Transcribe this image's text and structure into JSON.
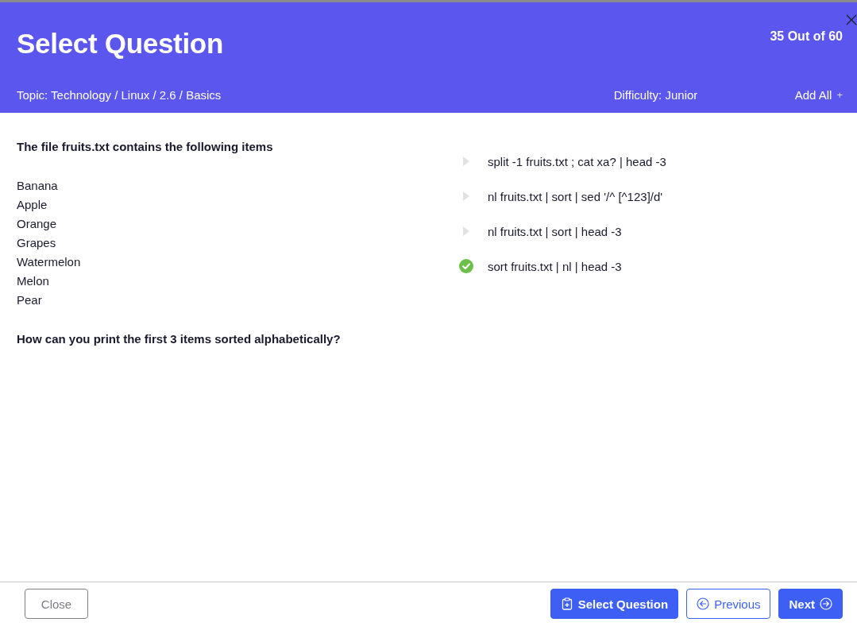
{
  "dialog": {
    "title": "Select Question",
    "counter": "35 Out of 60"
  },
  "meta": {
    "topic": "Topic: Technology / Linux / 2.6 / Basics",
    "difficulty": "Difficulty: Junior",
    "add_all": "Add All",
    "add_all_mark": "+"
  },
  "question": {
    "intro": "The file fruits.txt contains the following items",
    "items": [
      "Banana",
      "Apple",
      "Orange",
      "Grapes",
      "Watermelon",
      "Melon",
      "Pear"
    ],
    "prompt": "How can you print the first 3 items sorted alphabetically?"
  },
  "answers": [
    {
      "text": "split -1 fruits.txt ; cat xa? | head -3",
      "correct": false
    },
    {
      "text": "nl fruits.txt | sort | sed '/^ [^123]/d'",
      "correct": false
    },
    {
      "text": "nl fruits.txt | sort | head -3",
      "correct": false
    },
    {
      "text": "sort fruits.txt | nl | head -3",
      "correct": true
    }
  ],
  "footer": {
    "close": "Close",
    "select": "Select Question",
    "previous": "Previous",
    "next": "Next"
  }
}
